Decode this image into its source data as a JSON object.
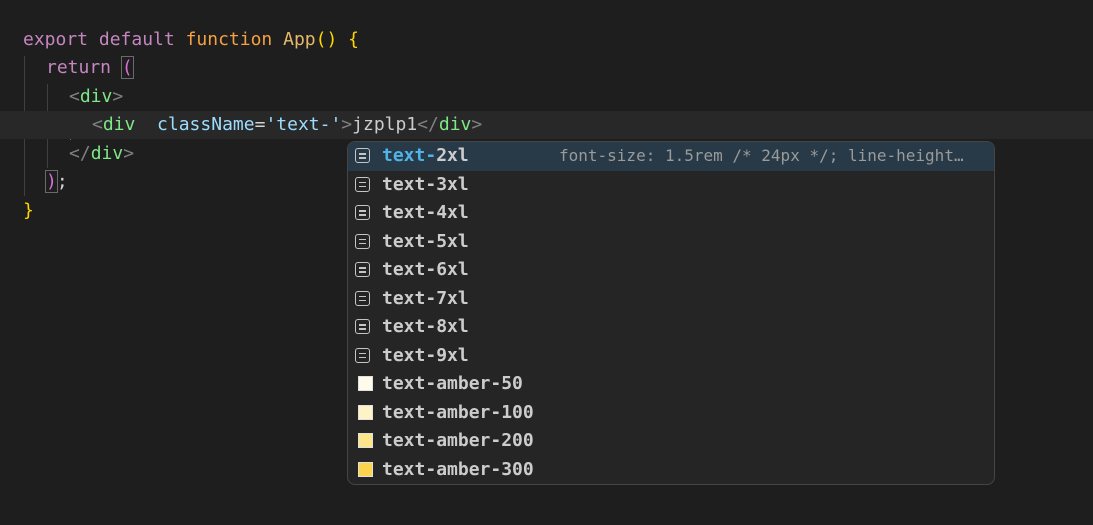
{
  "code": {
    "line1": {
      "export": "export",
      "default": "default",
      "function": "function",
      "name": "App",
      "parens": "()",
      "brace": "{"
    },
    "line2": {
      "return": "return",
      "paren": "("
    },
    "line3": {
      "open": "<",
      "tag": "div",
      "close": ">"
    },
    "line4": {
      "open": "<",
      "tag": "div",
      "attr": "className",
      "eq": "=",
      "str": "'text-'",
      "close": ">",
      "text": "jzplp1",
      "end_open": "</",
      "end_tag": "div",
      "end_close": ">"
    },
    "line5": {
      "open": "</",
      "tag": "div",
      "close": ">"
    },
    "line6": {
      "paren": ")",
      "semi": ";"
    },
    "line7": {
      "brace": "}"
    }
  },
  "suggestions": {
    "selected_detail": "font-size: 1.5rem /* 24px */; line-height…",
    "items": [
      {
        "match": "text-",
        "rest": "2xl",
        "icon": "constant-icon"
      },
      {
        "match": "text-",
        "rest": "3xl",
        "icon": "constant-icon"
      },
      {
        "match": "text-",
        "rest": "4xl",
        "icon": "constant-icon"
      },
      {
        "match": "text-",
        "rest": "5xl",
        "icon": "constant-icon"
      },
      {
        "match": "text-",
        "rest": "6xl",
        "icon": "constant-icon"
      },
      {
        "match": "text-",
        "rest": "7xl",
        "icon": "constant-icon"
      },
      {
        "match": "text-",
        "rest": "8xl",
        "icon": "constant-icon"
      },
      {
        "match": "text-",
        "rest": "9xl",
        "icon": "constant-icon"
      },
      {
        "match": "text-",
        "rest": "amber-50",
        "icon": "color-swatch",
        "color": "#fffbeb"
      },
      {
        "match": "text-",
        "rest": "amber-100",
        "icon": "color-swatch",
        "color": "#fef3c7"
      },
      {
        "match": "text-",
        "rest": "amber-200",
        "icon": "color-swatch",
        "color": "#fde68a"
      },
      {
        "match": "text-",
        "rest": "amber-300",
        "icon": "color-swatch",
        "color": "#fcd34d"
      }
    ]
  }
}
